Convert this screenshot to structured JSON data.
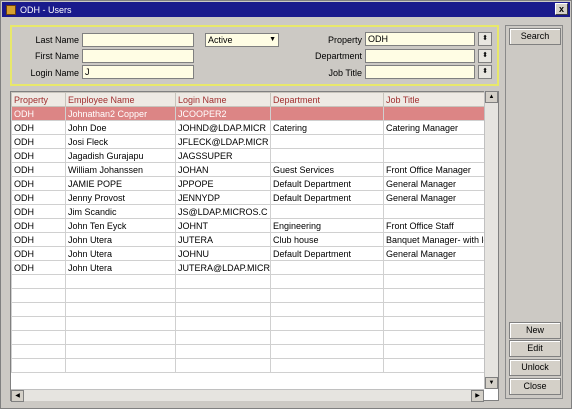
{
  "window": {
    "title": "ODH - Users",
    "close_label": "x"
  },
  "search": {
    "last_name_label": "Last Name",
    "first_name_label": "First Name",
    "login_name_label": "Login Name",
    "last_name_value": "",
    "first_name_value": "",
    "login_name_value": "J",
    "status_value": "Active",
    "property_label": "Property",
    "property_value": "ODH",
    "department_label": "Department",
    "department_value": "",
    "job_title_label": "Job Title",
    "job_title_value": ""
  },
  "buttons": {
    "search": "Search",
    "new": "New",
    "edit": "Edit",
    "unlock": "Unlock",
    "close": "Close"
  },
  "grid": {
    "columns": [
      "Property",
      "Employee Name",
      "Login Name",
      "Department",
      "Job Title"
    ],
    "rows": [
      [
        "ODH",
        "Johnathan2 Copper",
        "JCOOPER2",
        "",
        ""
      ],
      [
        "ODH",
        "John Doe",
        "JOHND@LDAP.MICR",
        "Catering",
        "Catering Manager"
      ],
      [
        "ODH",
        "Josi Fleck",
        "JFLECK@LDAP.MICR",
        "",
        ""
      ],
      [
        "ODH",
        "Jagadish Gurajapu",
        "JAGSSUPER",
        "",
        ""
      ],
      [
        "ODH",
        "William Johanssen",
        "JOHAN",
        "Guest Services",
        "Front Office Manager"
      ],
      [
        "ODH",
        "JAMIE POPE",
        "JPPOPE",
        "Default Department",
        "General Manager"
      ],
      [
        "ODH",
        "Jenny Provost",
        "JENNYDP",
        "Default Department",
        "General Manager"
      ],
      [
        "ODH",
        "Jim Scandic",
        "JS@LDAP.MICROS.C",
        "",
        ""
      ],
      [
        "ODH",
        "John Ten Eyck",
        "JOHNT",
        "Engineering",
        "Front Office Staff"
      ],
      [
        "ODH",
        "John Utera",
        "JUTERA",
        "Club house",
        "Banquet Manager- with lo"
      ],
      [
        "ODH",
        "John Utera",
        "JOHNU",
        "Default Department",
        "General Manager"
      ],
      [
        "ODH",
        "John Utera",
        "JUTERA@LDAP.MICR",
        "",
        ""
      ]
    ],
    "selected_row": 0,
    "empty_rows": 7
  },
  "icons": {
    "dropdown": "lov-button-icon",
    "scroll_up": "arrow-up-icon",
    "scroll_down": "arrow-down-icon",
    "scroll_left": "arrow-left-icon",
    "scroll_right": "arrow-right-icon"
  }
}
